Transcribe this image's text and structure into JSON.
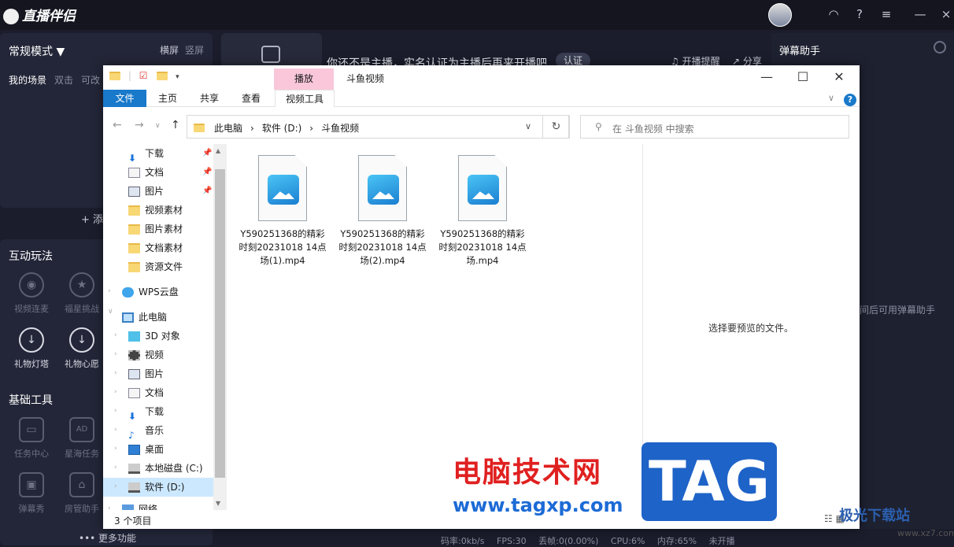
{
  "app": {
    "name": "直播伴侣",
    "mode_label": "常规模式 ▼",
    "orientation": [
      "横屏",
      "竖屏"
    ],
    "scene_tabs": [
      "我的场景",
      "双击",
      "可改"
    ],
    "add_scene": "+ 添",
    "interactive_title": "互动玩法",
    "interactive_tools": [
      {
        "label": "视频连麦",
        "active": false
      },
      {
        "label": "福星挑战",
        "active": false
      },
      {
        "label": "礼物灯塔",
        "active": true
      },
      {
        "label": "礼物心愿",
        "active": true
      }
    ],
    "basic_title": "基础工具",
    "basic_tools": [
      {
        "label": "任务中心",
        "active": false
      },
      {
        "label": "星海任务",
        "active": false
      },
      {
        "label": "弹幕秀",
        "active": false
      },
      {
        "label": "房管助手",
        "active": false
      }
    ],
    "more_functions": "••• 更多功能",
    "notice_text": "你还不是主播，实名认证为主播后再来开播吧",
    "auth_button": "认证",
    "remind_label": "开播提醒",
    "share_label": "分享",
    "danmu_title": "弹幕助手",
    "danmu_hint": "间后可用弹幕助手",
    "status": [
      "码率:0kb/s",
      "FPS:30",
      "丢帧:0(0.00%)",
      "CPU:6%",
      "内存:65%",
      "未开播"
    ]
  },
  "explorer": {
    "window_title": "斗鱼视频",
    "context_tab": "播放",
    "ribbon_tabs": [
      "文件",
      "主页",
      "共享",
      "查看",
      "视频工具"
    ],
    "address_path": [
      "此电脑",
      "›",
      "软件 (D:)",
      "›",
      "斗鱼视频"
    ],
    "search_placeholder": "在 斗鱼视频 中搜索",
    "nav_items": [
      {
        "label": "下载",
        "icon": "download-arrow-icon",
        "pinned": true
      },
      {
        "label": "文档",
        "icon": "document-icon",
        "pinned": true
      },
      {
        "label": "图片",
        "icon": "picture-icon",
        "pinned": true
      },
      {
        "label": "视频素材",
        "icon": "folder-icon",
        "pinned": false
      },
      {
        "label": "图片素材",
        "icon": "folder-icon",
        "pinned": false
      },
      {
        "label": "文档素材",
        "icon": "folder-icon",
        "pinned": false
      },
      {
        "label": "资源文件",
        "icon": "folder-icon",
        "pinned": false
      }
    ],
    "wps_cloud": "WPS云盘",
    "this_pc": "此电脑",
    "pc_items": [
      "3D 对象",
      "视频",
      "图片",
      "文档",
      "下载",
      "音乐",
      "桌面",
      "本地磁盘 (C:)",
      "软件 (D:)",
      "网络"
    ],
    "files": [
      "Y590251368的精彩时刻20231018 14点场(1).mp4",
      "Y590251368的精彩时刻20231018 14点场(2).mp4",
      "Y590251368的精彩时刻20231018 14点场.mp4"
    ],
    "preview_text": "选择要预览的文件。",
    "item_count": "3 个项目"
  },
  "watermark": {
    "cn_text": "电脑技术网",
    "url": "www.tagxp.com",
    "tag": "TAG",
    "aurora": "极光下载站",
    "site": "www.xz7.com"
  },
  "colors": {
    "accent": "#1979ca",
    "context_tab": "#f9c7d9",
    "selection": "#cce8ff"
  }
}
